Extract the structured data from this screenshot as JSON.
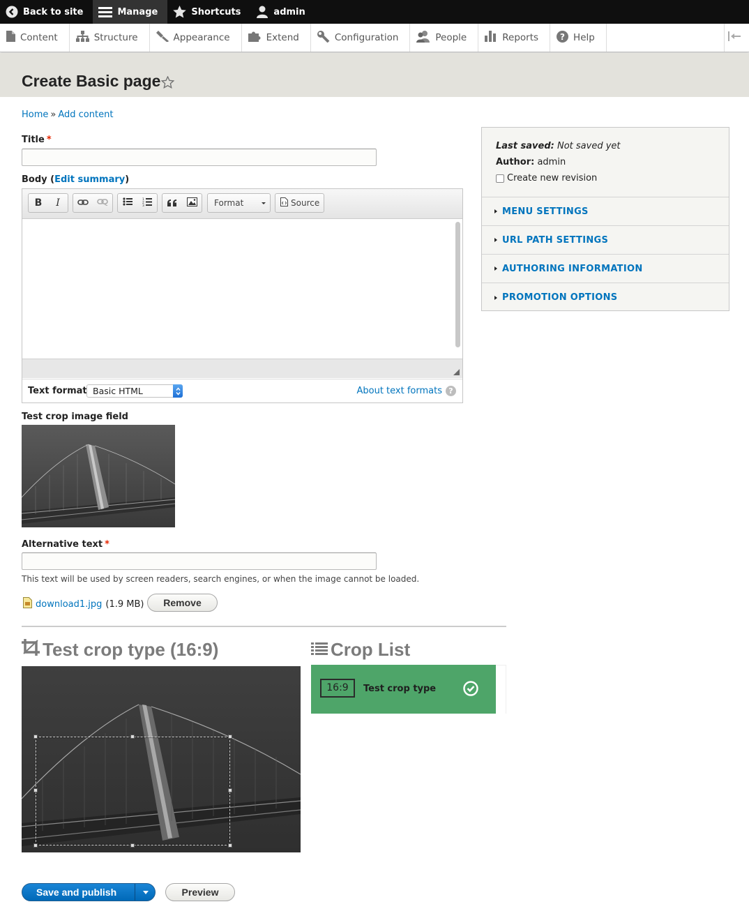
{
  "toolbar": {
    "back_to_site": "Back to site",
    "manage": "Manage",
    "shortcuts": "Shortcuts",
    "user": "admin"
  },
  "tray": {
    "items": [
      {
        "label": "Content",
        "icon": "file-icon"
      },
      {
        "label": "Structure",
        "icon": "sitemap-icon"
      },
      {
        "label": "Appearance",
        "icon": "paintbrush-icon"
      },
      {
        "label": "Extend",
        "icon": "puzzle-icon"
      },
      {
        "label": "Configuration",
        "icon": "wrench-icon"
      },
      {
        "label": "People",
        "icon": "people-icon"
      },
      {
        "label": "Reports",
        "icon": "bar-chart-icon"
      },
      {
        "label": "Help",
        "icon": "help-icon"
      }
    ]
  },
  "page": {
    "title": "Create Basic page"
  },
  "breadcrumb": {
    "home": "Home",
    "separator": "»",
    "add_content": "Add content"
  },
  "form": {
    "title_label": "Title",
    "required_mark": "*",
    "title_value": "",
    "body_label": "Body",
    "body_paren_open": "(",
    "edit_summary": "Edit summary",
    "body_paren_close": ")",
    "editor": {
      "format_label": "Format",
      "source_label": "Source",
      "text_format_label": "Text format",
      "text_format_value": "Basic HTML",
      "about_text_formats": "About text formats",
      "help_glyph": "?"
    },
    "image_field_label": "Test crop image field",
    "alt_label": "Alternative text",
    "alt_value": "",
    "alt_description": "This text will be used by screen readers, search engines, or when the image cannot be loaded.",
    "file_name": "download1.jpg",
    "file_size": "(1.9 MB)",
    "remove_button": "Remove"
  },
  "crop": {
    "title": "Test crop type (16:9)",
    "list_title": "Crop List",
    "item_ratio": "16:9",
    "item_label": "Test crop type",
    "item_color": "#4ea569"
  },
  "sidebar": {
    "last_saved_label": "Last saved:",
    "last_saved_value": "Not saved yet",
    "author_label": "Author:",
    "author_value": "admin",
    "create_revision_label": "Create new revision",
    "create_revision_checked": false,
    "sections": [
      "MENU SETTINGS",
      "URL PATH SETTINGS",
      "AUTHORING INFORMATION",
      "PROMOTION OPTIONS"
    ]
  },
  "actions": {
    "save_publish": "Save and publish",
    "preview": "Preview"
  },
  "colors": {
    "link": "#0074bd",
    "primary_button": "#0074bd",
    "required": "#e62600",
    "header_bg": "#e3e2dc",
    "toolbar_bg": "#0f0f0f"
  }
}
